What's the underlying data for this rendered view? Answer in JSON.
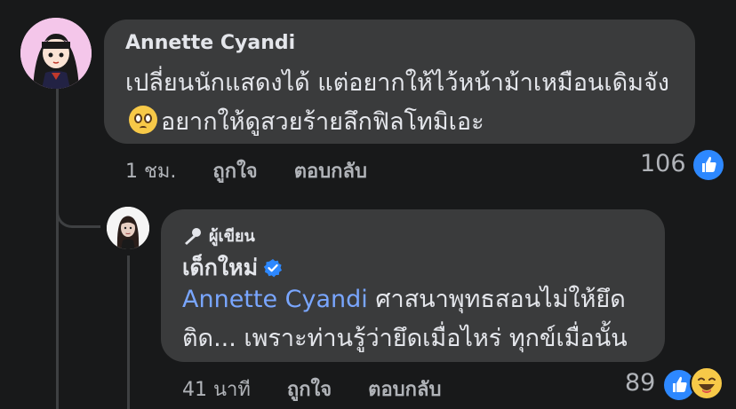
{
  "comment": {
    "author": "Annette Cyandi",
    "text_before_emoji": "เปลี่ยนนักแสดงได้ แต่อยากให้ไว้หน้าม้าเหมือนเดิมจัง",
    "emoji": "pleading-face",
    "text_after_emoji": "อยากให้ดูสวยร้ายลึกฟิลโทมิเอะ",
    "time": "1 ชม.",
    "like_label": "ถูกใจ",
    "reply_label": "ตอบกลับ",
    "reaction_count": "106",
    "reactions": [
      "like"
    ]
  },
  "reply": {
    "badge": "ผู้เขียน",
    "author": "เด็กใหม่",
    "verified": true,
    "mention": "Annette Cyandi",
    "text": "ศาสนาพุทธสอนไม่ให้ยึดติด... เพราะท่านรู้ว่ายึดเมื่อไหร่ ทุกข์เมื่อนั้น",
    "time": "41 นาที",
    "like_label": "ถูกใจ",
    "reply_label": "ตอบกลับ",
    "reaction_count": "89",
    "reactions": [
      "like",
      "haha"
    ]
  },
  "colors": {
    "background": "#18191a",
    "bubble": "#3a3b3c",
    "text": "#e4e6eb",
    "meta": "#b0b3b8",
    "mention": "#79a6ff",
    "like": "#2d88ff",
    "verified": "#2d88ff"
  }
}
